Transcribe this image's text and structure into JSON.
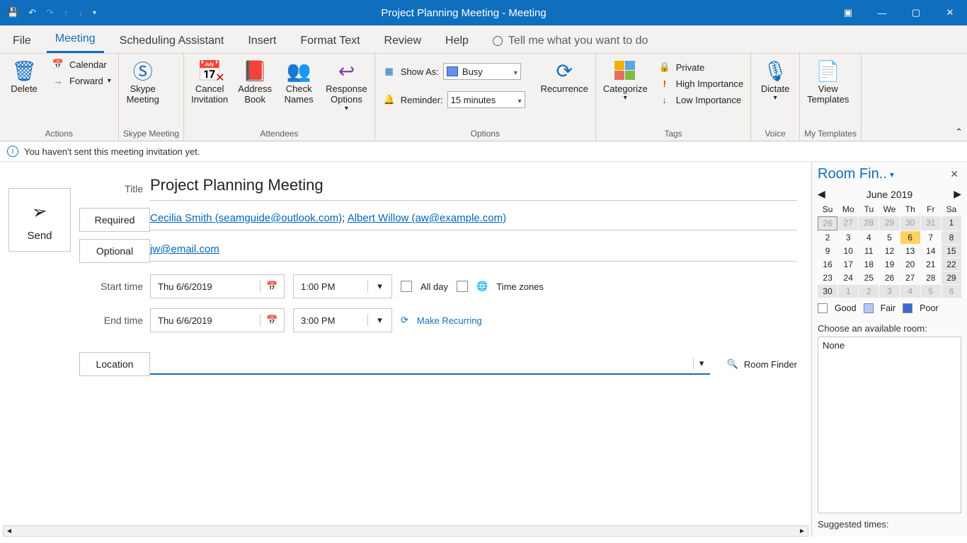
{
  "titlebar": {
    "title": "Project Planning Meeting  -  Meeting"
  },
  "tabs": {
    "file": "File",
    "meeting": "Meeting",
    "scheduling": "Scheduling Assistant",
    "insert": "Insert",
    "format": "Format Text",
    "review": "Review",
    "help": "Help",
    "tellme": "Tell me what you want to do"
  },
  "ribbon": {
    "actions": {
      "delete": "Delete",
      "calendar": "Calendar",
      "forward": "Forward",
      "label": "Actions"
    },
    "skype": {
      "btn": "Skype\nMeeting",
      "label": "Skype Meeting"
    },
    "attendees": {
      "cancel": "Cancel\nInvitation",
      "address": "Address\nBook",
      "check": "Check\nNames",
      "response": "Response\nOptions",
      "label": "Attendees"
    },
    "options": {
      "showas_label": "Show As:",
      "showas_value": "Busy",
      "reminder_label": "Reminder:",
      "reminder_value": "15 minutes",
      "recurrence": "Recurrence",
      "label": "Options"
    },
    "tags": {
      "categorize": "Categorize",
      "private": "Private",
      "high": "High Importance",
      "low": "Low Importance",
      "label": "Tags"
    },
    "voice": {
      "dictate": "Dictate",
      "label": "Voice"
    },
    "templates": {
      "view": "View\nTemplates",
      "label": "My Templates"
    }
  },
  "infobar": "You haven't sent this meeting invitation yet.",
  "form": {
    "send": "Send",
    "title_label": "Title",
    "title_value": "Project Planning Meeting",
    "required_btn": "Required",
    "required_people": [
      {
        "display": "Cecilia Smith (seamguide@outlook.com)"
      },
      {
        "display": "Albert Willow (aw@example.com)"
      }
    ],
    "optional_btn": "Optional",
    "optional_value": "jw@email.com",
    "start_label": "Start time",
    "start_date": "Thu 6/6/2019",
    "start_time": "1:00 PM",
    "end_label": "End time",
    "end_date": "Thu 6/6/2019",
    "end_time": "3:00 PM",
    "allday": "All day",
    "timezones": "Time zones",
    "recurring": "Make Recurring",
    "location_btn": "Location",
    "room_finder_btn": "Room Finder"
  },
  "room_finder": {
    "title": "Room Fin..",
    "month": "June 2019",
    "dow": [
      "Su",
      "Mo",
      "Tu",
      "We",
      "Th",
      "Fr",
      "Sa"
    ],
    "weeks": [
      [
        "26",
        "27",
        "28",
        "29",
        "30",
        "31",
        "1"
      ],
      [
        "2",
        "3",
        "4",
        "5",
        "6",
        "7",
        "8"
      ],
      [
        "9",
        "10",
        "11",
        "12",
        "13",
        "14",
        "15"
      ],
      [
        "16",
        "17",
        "18",
        "19",
        "20",
        "21",
        "22"
      ],
      [
        "23",
        "24",
        "25",
        "26",
        "27",
        "28",
        "29"
      ],
      [
        "30",
        "1",
        "2",
        "3",
        "4",
        "5",
        "6"
      ]
    ],
    "legend": {
      "good": "Good",
      "fair": "Fair",
      "poor": "Poor"
    },
    "choose_label": "Choose an available room:",
    "room_none": "None",
    "suggested_label": "Suggested times:"
  }
}
